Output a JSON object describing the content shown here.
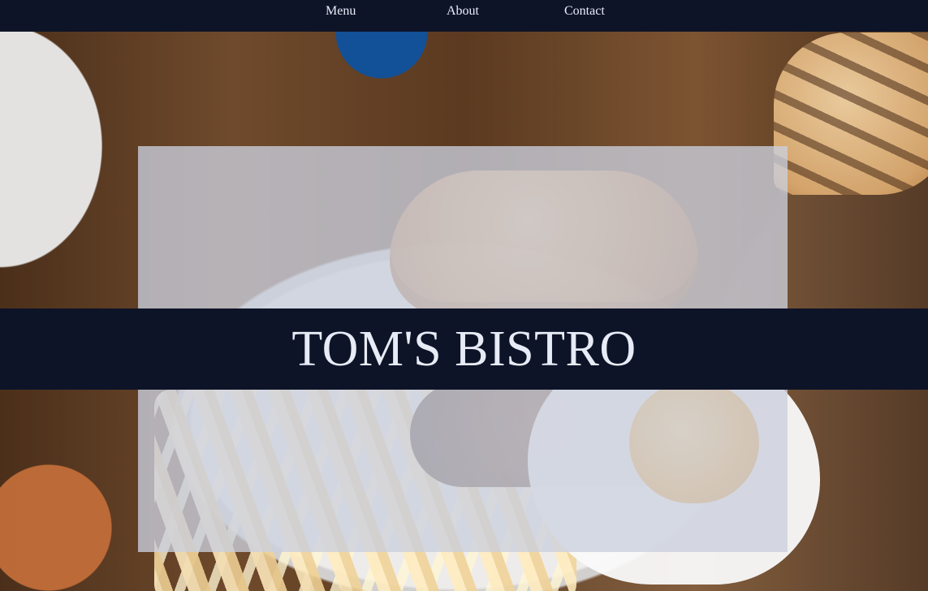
{
  "nav": {
    "items": [
      {
        "label": "Menu"
      },
      {
        "label": "About"
      },
      {
        "label": "Contact"
      }
    ]
  },
  "hero": {
    "title": "TOM'S BISTRO"
  }
}
